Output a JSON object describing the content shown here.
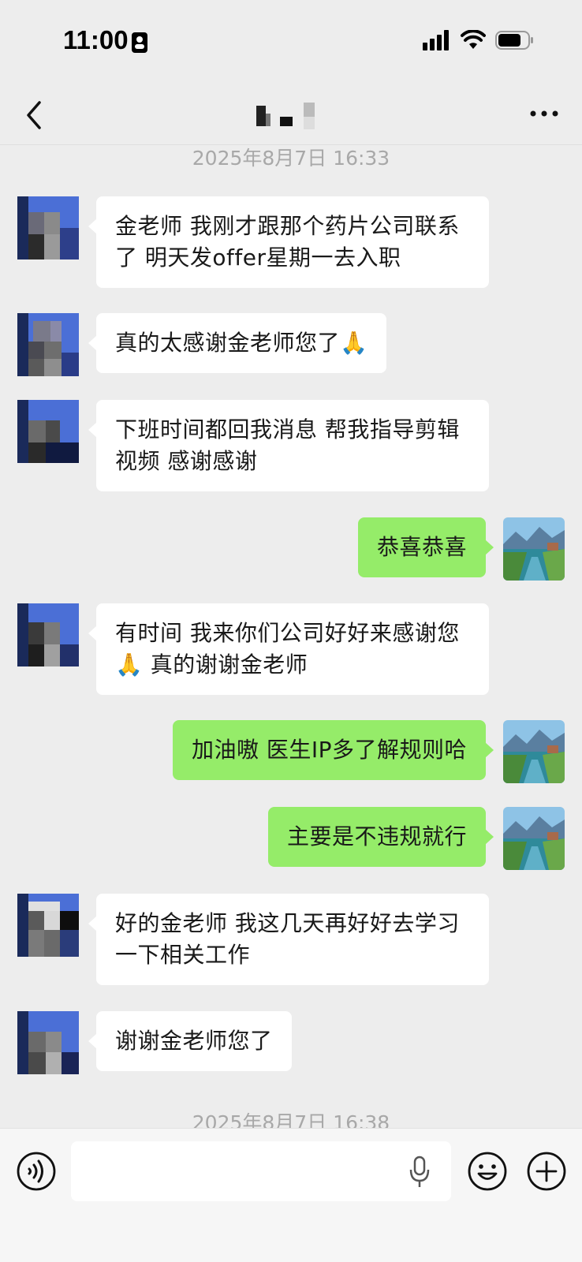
{
  "status_bar": {
    "time": "11:00"
  },
  "nav": {
    "back_icon": "chevron-left-icon",
    "more_icon": "ellipsis-icon"
  },
  "timestamps": [
    "2025年8月7日 16:33",
    "2025年8月7日 16:38"
  ],
  "messages": [
    {
      "side": "in",
      "text": "金老师 我刚才跟那个药片公司联系了 明天发offer星期一去入职"
    },
    {
      "side": "in",
      "text": "真的太感谢金老师您了🙏"
    },
    {
      "side": "in",
      "text": "下班时间都回我消息 帮我指导剪辑视频 感谢感谢"
    },
    {
      "side": "out",
      "text": "恭喜恭喜"
    },
    {
      "side": "in",
      "text": "有时间 我来你们公司好好来感谢您🙏 真的谢谢金老师"
    },
    {
      "side": "out",
      "text": "加油嗷  医生IP多了解规则哈"
    },
    {
      "side": "out",
      "text": "主要是不违规就行"
    },
    {
      "side": "in",
      "text": "好的金老师 我这几天再好好去学习一下相关工作"
    },
    {
      "side": "in",
      "text": "谢谢金老师您了"
    }
  ],
  "input_bar": {
    "voice_icon": "voice-toggle-icon",
    "input_value": "",
    "mic_icon": "microphone-icon",
    "emoji_icon": "emoji-icon",
    "plus_icon": "plus-icon"
  },
  "colors": {
    "background": "#ededed",
    "incoming_bubble": "#ffffff",
    "outgoing_bubble": "#95ec69",
    "timestamp": "#a8a8a8"
  }
}
